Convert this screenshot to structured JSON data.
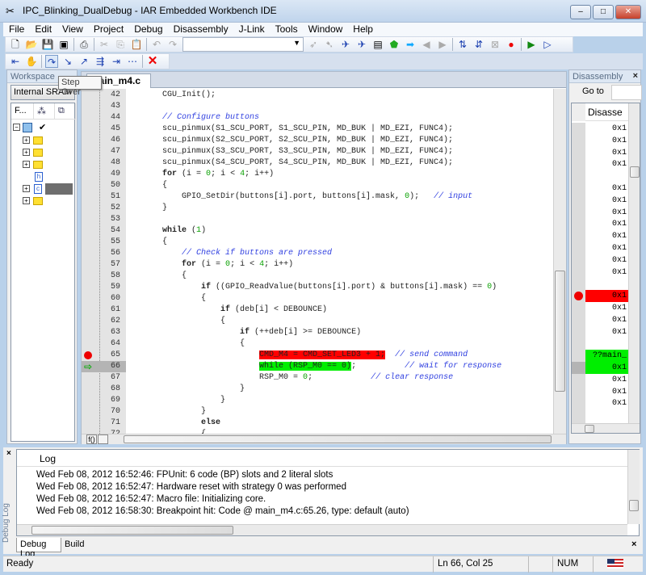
{
  "window": {
    "title": "IPC_Blinking_DualDebug - IAR Embedded Workbench IDE"
  },
  "menu": [
    "File",
    "Edit",
    "View",
    "Project",
    "Debug",
    "Disassembly",
    "J-Link",
    "Tools",
    "Window",
    "Help"
  ],
  "tooltip": "Step Over",
  "workspace": {
    "title": "Workspace",
    "config": "Internal SRAM",
    "columns": [
      "F..."
    ]
  },
  "editor": {
    "tab": "main_m4.c",
    "lines": [
      {
        "n": "42",
        "s": [
          [
            "    CGU_Init();",
            ""
          ]
        ]
      },
      {
        "n": "43",
        "s": []
      },
      {
        "n": "44",
        "s": [
          [
            "    ",
            ""
          ],
          [
            "// Configure buttons",
            "c"
          ]
        ]
      },
      {
        "n": "45",
        "s": [
          [
            "    scu_pinmux(S1_SCU_PORT, S1_SCU_PIN, MD_BUK | MD_EZI, FUNC4);",
            ""
          ]
        ]
      },
      {
        "n": "46",
        "s": [
          [
            "    scu_pinmux(S2_SCU_PORT, S2_SCU_PIN, MD_BUK | MD_EZI, FUNC4);",
            ""
          ]
        ]
      },
      {
        "n": "47",
        "s": [
          [
            "    scu_pinmux(S3_SCU_PORT, S3_SCU_PIN, MD_BUK | MD_EZI, FUNC4);",
            ""
          ]
        ]
      },
      {
        "n": "48",
        "s": [
          [
            "    scu_pinmux(S4_SCU_PORT, S4_SCU_PIN, MD_BUK | MD_EZI, FUNC4);",
            ""
          ]
        ]
      },
      {
        "n": "49",
        "s": [
          [
            "    ",
            ""
          ],
          [
            "for",
            "k"
          ],
          [
            " (i = ",
            ""
          ],
          [
            "0",
            "n"
          ],
          [
            "; i < ",
            ""
          ],
          [
            "4",
            "n"
          ],
          [
            "; i++)",
            ""
          ]
        ]
      },
      {
        "n": "50",
        "s": [
          [
            "    {",
            ""
          ]
        ]
      },
      {
        "n": "51",
        "s": [
          [
            "        GPIO_SetDir(buttons[i].port, buttons[i].mask, ",
            ""
          ],
          [
            "0",
            "n"
          ],
          [
            ");   ",
            ""
          ],
          [
            "// input",
            "c"
          ]
        ]
      },
      {
        "n": "52",
        "s": [
          [
            "    }",
            ""
          ]
        ]
      },
      {
        "n": "53",
        "s": []
      },
      {
        "n": "54",
        "s": [
          [
            "    ",
            ""
          ],
          [
            "while",
            "k"
          ],
          [
            " (",
            ""
          ],
          [
            "1",
            "n"
          ],
          [
            ")",
            ""
          ]
        ]
      },
      {
        "n": "55",
        "s": [
          [
            "    {",
            ""
          ]
        ]
      },
      {
        "n": "56",
        "s": [
          [
            "        ",
            ""
          ],
          [
            "// Check if buttons are pressed",
            "c"
          ]
        ]
      },
      {
        "n": "57",
        "s": [
          [
            "        ",
            ""
          ],
          [
            "for",
            "k"
          ],
          [
            " (i = ",
            ""
          ],
          [
            "0",
            "n"
          ],
          [
            "; i < ",
            ""
          ],
          [
            "4",
            "n"
          ],
          [
            "; i++)",
            ""
          ]
        ]
      },
      {
        "n": "58",
        "s": [
          [
            "        {",
            ""
          ]
        ]
      },
      {
        "n": "59",
        "s": [
          [
            "            ",
            ""
          ],
          [
            "if",
            "k"
          ],
          [
            " ((GPIO_ReadValue(buttons[i].port) & buttons[i].mask) == ",
            ""
          ],
          [
            "0",
            "n"
          ],
          [
            ")",
            ""
          ]
        ]
      },
      {
        "n": "60",
        "s": [
          [
            "            {",
            ""
          ]
        ]
      },
      {
        "n": "61",
        "s": [
          [
            "                ",
            ""
          ],
          [
            "if",
            "k"
          ],
          [
            " (deb[i] < DEBOUNCE)",
            ""
          ]
        ]
      },
      {
        "n": "62",
        "s": [
          [
            "                {",
            ""
          ]
        ]
      },
      {
        "n": "63",
        "s": [
          [
            "                    ",
            ""
          ],
          [
            "if",
            "k"
          ],
          [
            " (++deb[i] >= DEBOUNCE)",
            ""
          ]
        ]
      },
      {
        "n": "64",
        "s": [
          [
            "                    {",
            ""
          ]
        ]
      },
      {
        "n": "65",
        "bp": true,
        "s": [
          [
            "                        ",
            ""
          ],
          [
            "CMD_M4 = CMD_SET_LED3 + 1;",
            "bp"
          ],
          [
            "  ",
            ""
          ],
          [
            "// send command",
            "c"
          ]
        ]
      },
      {
        "n": "66",
        "cur": true,
        "s": [
          [
            "                        ",
            ""
          ],
          [
            "while (RSP_M0 == 0)",
            "pc"
          ],
          [
            ";          ",
            ""
          ],
          [
            "// wait for response",
            "c"
          ]
        ]
      },
      {
        "n": "67",
        "s": [
          [
            "                        RSP_M0 = ",
            ""
          ],
          [
            "0",
            "n"
          ],
          [
            ";            ",
            ""
          ],
          [
            "// clear response",
            "c"
          ]
        ]
      },
      {
        "n": "68",
        "s": [
          [
            "                    }",
            ""
          ]
        ]
      },
      {
        "n": "69",
        "s": [
          [
            "                }",
            ""
          ]
        ]
      },
      {
        "n": "70",
        "s": [
          [
            "            }",
            ""
          ]
        ]
      },
      {
        "n": "71",
        "s": [
          [
            "            ",
            ""
          ],
          [
            "else",
            "k"
          ]
        ]
      },
      {
        "n": "72",
        "s": [
          [
            "            {",
            ""
          ]
        ]
      }
    ],
    "bottom_buttons": [
      "f()"
    ]
  },
  "disassembly": {
    "title": "Disassembly",
    "goto_label": "Go to",
    "column": "Disasse",
    "rows": [
      {
        "t": "0x1"
      },
      {
        "t": "0x1"
      },
      {
        "t": "0x1"
      },
      {
        "t": "0x1"
      },
      {
        "t": ""
      },
      {
        "t": "0x1"
      },
      {
        "t": "0x1"
      },
      {
        "t": "0x1"
      },
      {
        "t": "0x1"
      },
      {
        "t": "0x1"
      },
      {
        "t": "0x1"
      },
      {
        "t": "0x1"
      },
      {
        "t": "0x1"
      },
      {
        "t": ""
      },
      {
        "t": "0x1",
        "bp": true
      },
      {
        "t": "0x1"
      },
      {
        "t": "0x1"
      },
      {
        "t": "0x1"
      },
      {
        "t": ""
      },
      {
        "t": "??main_",
        "pc": true
      },
      {
        "t": "0x1",
        "pc": true,
        "cur": true
      },
      {
        "t": "0x1"
      },
      {
        "t": "0x1"
      },
      {
        "t": "0x1"
      },
      {
        "t": ""
      },
      {
        "t": "0x1"
      }
    ]
  },
  "log": {
    "side_label": "Debug Log",
    "header": "Log",
    "rows": [
      "Wed Feb 08, 2012 16:52:46:  FPUnit: 6 code (BP) slots and 2 literal slots",
      "Wed Feb 08, 2012 16:52:47: Hardware reset with strategy 0 was performed",
      "Wed Feb 08, 2012 16:52:47: Macro file: Initializing core.",
      "Wed Feb 08, 2012 16:58:30: Breakpoint hit: Code @ main_m4.c:65.26, type: default (auto)"
    ],
    "tabs": [
      "Debug Log",
      "Build"
    ]
  },
  "status": {
    "text": "Ready",
    "position": "Ln 66, Col 25",
    "num": "NUM"
  },
  "colors": {
    "breakpoint": "#ff0000",
    "current": "#00ee00",
    "comment": "#2f3fe0",
    "number": "#08a000"
  }
}
